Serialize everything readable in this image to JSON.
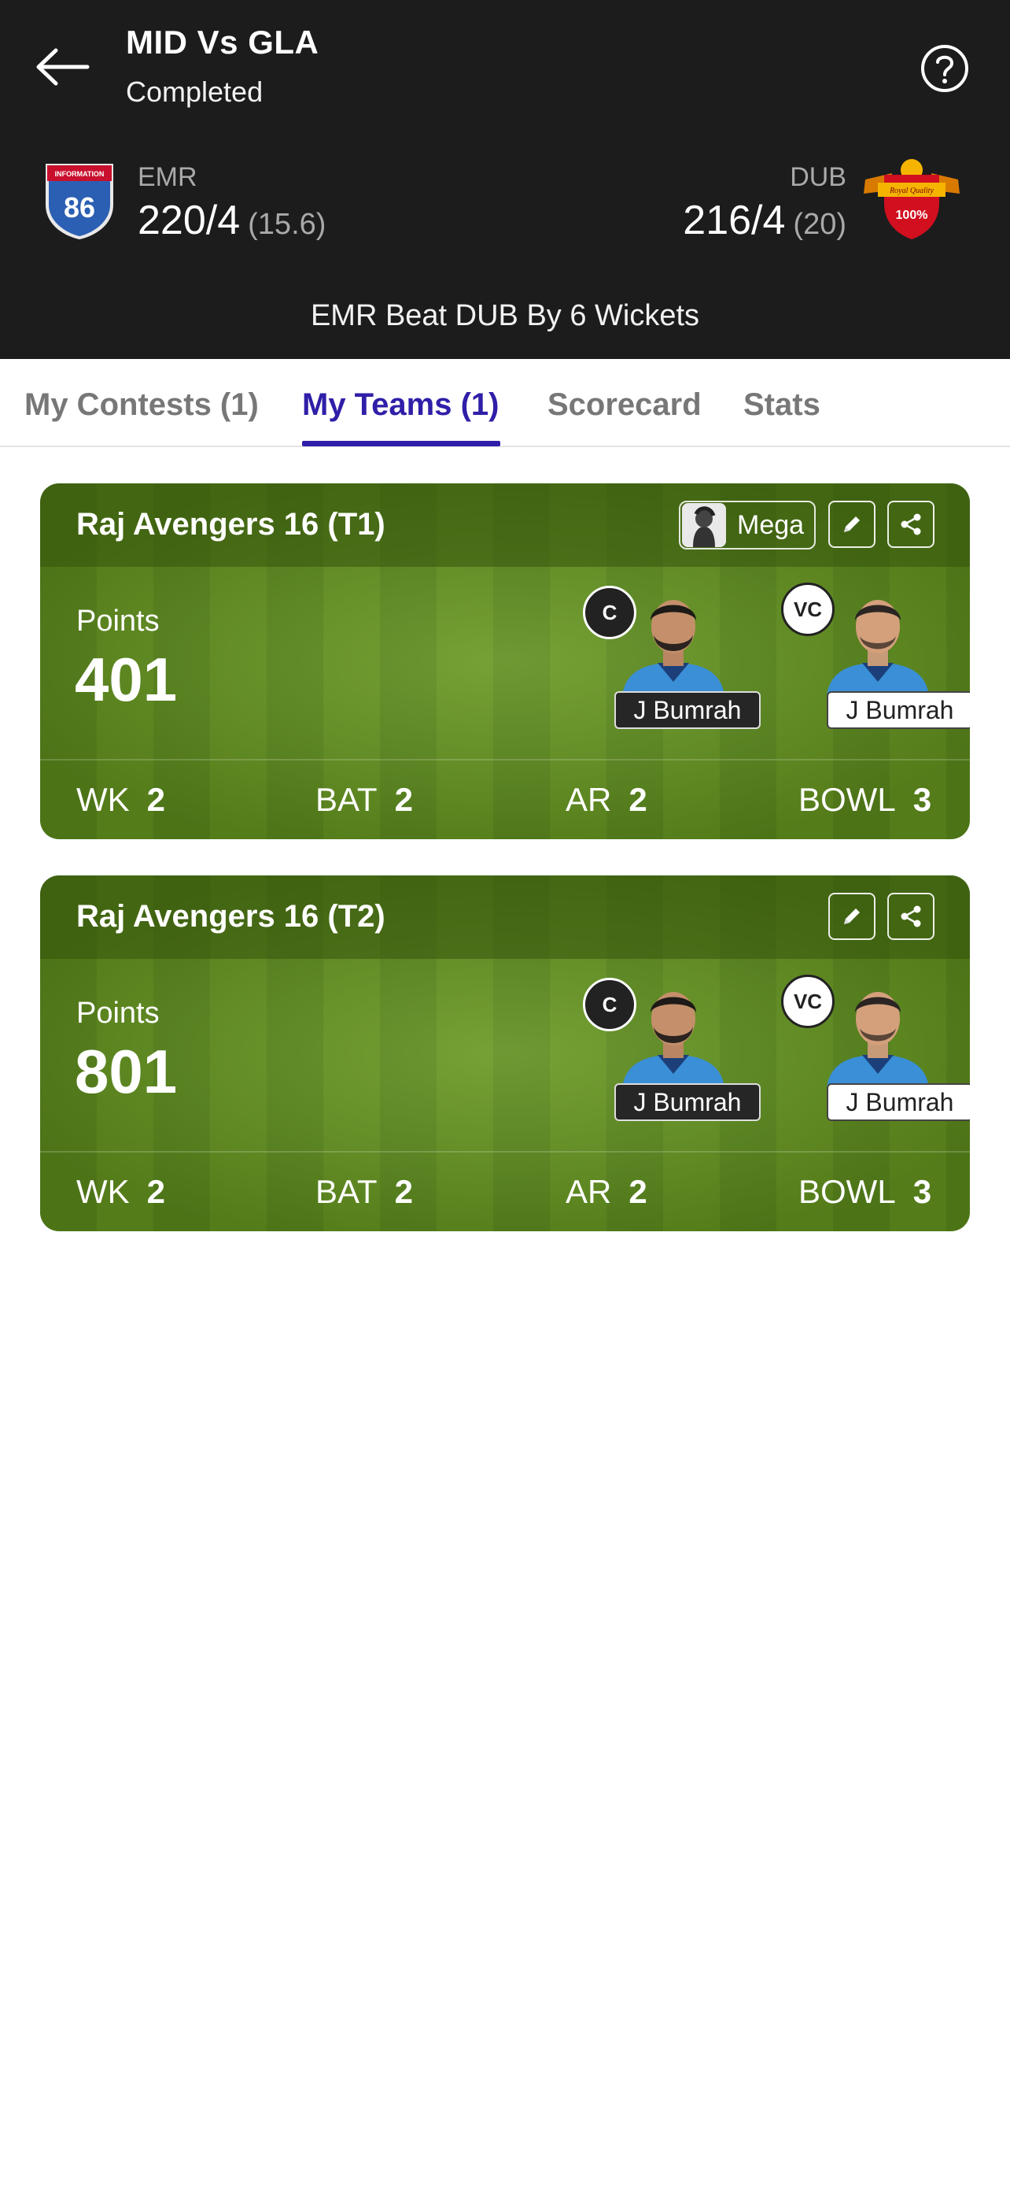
{
  "header": {
    "title": "MID Vs GLA",
    "status": "Completed",
    "result": "EMR Beat DUB By 6 Wickets",
    "team_left": {
      "code": "EMR",
      "score": "220/4",
      "overs": "(15.6)",
      "logo_text": "86",
      "logo_banner": "INFORMATION"
    },
    "team_right": {
      "code": "DUB",
      "score": "216/4",
      "overs": "(20)",
      "logo_text": "100%",
      "logo_banner": "Royal Quality"
    }
  },
  "tabs": [
    {
      "label": "My Contests (1)"
    },
    {
      "label": "My Teams (1)"
    },
    {
      "label": "Scorecard"
    },
    {
      "label": "Stats"
    }
  ],
  "teams": [
    {
      "name": "Raj Avengers 16 (T1)",
      "contest_chip": "Mega",
      "points_label": "Points",
      "points": "401",
      "captain": {
        "badge": "C",
        "name": "J Bumrah"
      },
      "vice_captain": {
        "badge": "VC",
        "name": "J Bumrah"
      },
      "stats": [
        {
          "label": "WK",
          "value": "2"
        },
        {
          "label": "BAT",
          "value": "2"
        },
        {
          "label": "AR",
          "value": "2"
        },
        {
          "label": "BOWL",
          "value": "3"
        }
      ]
    },
    {
      "name": "Raj Avengers 16 (T2)",
      "points_label": "Points",
      "points": "801",
      "captain": {
        "badge": "C",
        "name": "J Bumrah"
      },
      "vice_captain": {
        "badge": "VC",
        "name": "J Bumrah"
      },
      "stats": [
        {
          "label": "WK",
          "value": "2"
        },
        {
          "label": "BAT",
          "value": "2"
        },
        {
          "label": "AR",
          "value": "2"
        },
        {
          "label": "BOWL",
          "value": "3"
        }
      ]
    }
  ],
  "colors": {
    "header_bg": "#1c1c1d",
    "tab_active": "#2f1fa8",
    "pitch_green": "#5d8d1c"
  }
}
